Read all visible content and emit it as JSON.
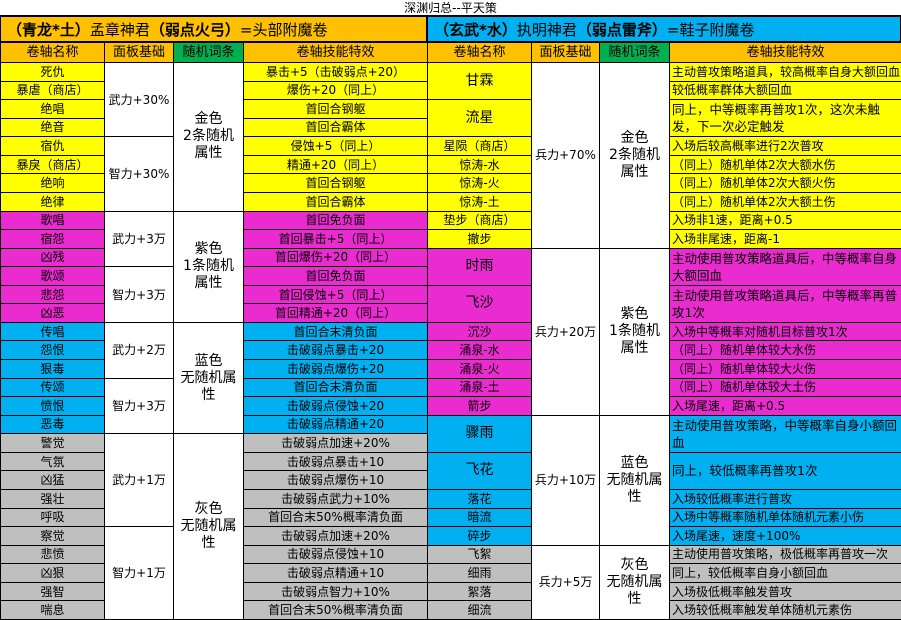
{
  "title": "深渊归总--平天策",
  "left": {
    "band": {
      "prefix": "（青龙*土）",
      "name": "孟章神君",
      "weak": "（弱点火弓）",
      "suffix": "=头部附魔卷"
    },
    "headers": [
      "卷轴名称",
      "面板基础",
      "随机词条",
      "卷轴技能特效"
    ],
    "rows": [
      [
        "死仇",
        "暴击+5（击破弱点+20）"
      ],
      [
        "暴虐（商店）",
        "爆伤+20（同上）"
      ],
      [
        "绝唱",
        "首回合钢躯"
      ],
      [
        "绝音",
        "首回合霸体"
      ],
      [
        "宿仇",
        "侵蚀+5（同上）"
      ],
      [
        "暴戾（商店）",
        "精通+20（同上）"
      ],
      [
        "绝响",
        "首回合钢躯"
      ],
      [
        "绝律",
        "首回合霸体"
      ],
      [
        "歌唱",
        "首回免负面"
      ],
      [
        "宿怨",
        "首回暴击+5（同上）"
      ],
      [
        "凶残",
        "首回爆伤+20（同上）"
      ],
      [
        "歌颂",
        "首回免负面"
      ],
      [
        "悲怨",
        "首回侵蚀+5（同上）"
      ],
      [
        "凶恶",
        "首回精通+20（同上）"
      ],
      [
        "传唱",
        "首回合末清负面"
      ],
      [
        "怨恨",
        "击破弱点暴击+20"
      ],
      [
        "狠毒",
        "击破弱点爆伤+20"
      ],
      [
        "传颂",
        "首回合末清负面"
      ],
      [
        "愤恨",
        "击破弱点侵蚀+20"
      ],
      [
        "恶毒",
        "击破弱点精通+20"
      ],
      [
        "警觉",
        "击破弱点加速+20%"
      ],
      [
        "气氛",
        "击破弱点暴击+10"
      ],
      [
        "凶猛",
        "击破弱点爆伤+10"
      ],
      [
        "强壮",
        "击破弱点武力+10%"
      ],
      [
        "呼吸",
        "首回合末50%概率清负面"
      ],
      [
        "察觉",
        "击破弱点加速+20%"
      ],
      [
        "悲愤",
        "击破弱点侵蚀+10"
      ],
      [
        "凶狠",
        "击破弱点精通+10"
      ],
      [
        "强智",
        "击破弱点智力+10%"
      ],
      [
        "喘息",
        "首回合末50%概率清负面"
      ]
    ],
    "base": [
      "武力+30%",
      "智力+30%",
      "武力+3万",
      "智力+3万",
      "武力+2万",
      "智力+3万",
      "武力+1万",
      "智力+1万"
    ],
    "rand": [
      "金色\n2条随机\n属性",
      "紫色\n1条随机\n属性",
      "蓝色\n无随机属\n性",
      "灰色\n无随机属\n性"
    ]
  },
  "right": {
    "band": {
      "prefix": "（玄武*水）",
      "name": "执明神君",
      "weak": "（弱点雷斧）",
      "suffix": "=鞋子附魔卷"
    },
    "headers": [
      "卷轴名称",
      "面板基础",
      "随机词条",
      "卷轴技能特效"
    ],
    "names": [
      "甘霖",
      "流星",
      "星陨（商店）",
      "惊涛-水",
      "惊涛-火",
      "惊涛-土",
      "垫步（商店）",
      "撤步",
      "时雨",
      "飞沙",
      "沉沙",
      "涌泉-水",
      "涌泉-火",
      "涌泉-土",
      "箭步",
      "骤雨",
      "飞花",
      "落花",
      "暗流",
      "碎步",
      "飞絮",
      "细雨",
      "絮落",
      "细流"
    ],
    "effects": [
      "主动普攻策略道具，较高概率自身大额回血",
      "较低概率群体大额回血",
      "同上，中等概率再普攻1次，这次未触发，下一次必定触发",
      "入场后较高概率进行2次普攻",
      "（同上）随机单体2次大额水伤",
      "（同上）随机单体2次大额火伤",
      "（同上）随机单体2次大额土伤",
      "入场非1速，距离+0.5",
      "入场非尾速，距离-1",
      "主动使用普攻策略道具后，中等概率自身大额回血",
      "主动使用普攻策略道具后，中等概率再普攻1次",
      "入场中等概率对随机目标普攻1次",
      "（同上）随机单体较大水伤",
      "（同上）随机单体较大火伤",
      "（同上）随机单体较大土伤",
      "入场尾速，距离+0.5",
      "主动使用普攻策略，中等概率自身小额回血",
      "同上，较低概率再普攻1次",
      "入场较低概率进行普攻",
      "入场中等概率随机单体随机元素小伤",
      "入场尾速，速度+100%",
      "主动使用普攻策略，极低概率再普攻一次",
      "同上，较低概率自身小额回血",
      "入场极低概率触发普攻",
      "入场较低概率触发单体随机元素伤"
    ],
    "base": [
      "兵力+70%",
      "兵力+20万",
      "兵力+10万",
      "兵力+5万"
    ],
    "rand": [
      "金色\n2条随机\n属性",
      "紫色\n1条随机\n属性",
      "蓝色\n无随机属\n性",
      "灰色\n无随机属\n性"
    ]
  },
  "colors": {
    "yellow": "#ffff00",
    "magenta": "#ea2bd0",
    "cyan": "#00b0f0",
    "grey": "#bfbfbf",
    "header": "#ffc000",
    "header_rand": "#00b050"
  }
}
